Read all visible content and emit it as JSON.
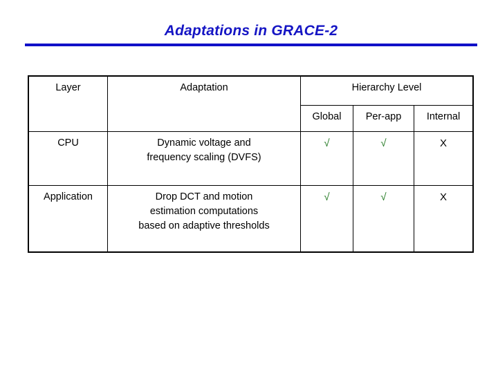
{
  "slide": {
    "title": "Adaptations in GRACE-2",
    "title_color": "#1515c4",
    "rule_color": "#1010c8",
    "background_color": "#ffffff"
  },
  "table": {
    "headers": {
      "layer": "Layer",
      "adaptation": "Adaptation",
      "hierarchy_level": "Hierarchy Level",
      "sub": {
        "global": "Global",
        "per_app": "Per-app",
        "internal": "Internal"
      }
    },
    "rows": [
      {
        "layer": "CPU",
        "adaptation_lines": [
          "Dynamic voltage and",
          "frequency scaling (DVFS)"
        ],
        "global": "√",
        "per_app": "√",
        "internal": "X"
      },
      {
        "layer": "Application",
        "adaptation_lines": [
          "Drop DCT and motion",
          "estimation computations",
          "based on adaptive thresholds"
        ],
        "global": "√",
        "per_app": "√",
        "internal": "X"
      }
    ],
    "mark_colors": {
      "check": "#217821",
      "cross": "#000000"
    }
  }
}
